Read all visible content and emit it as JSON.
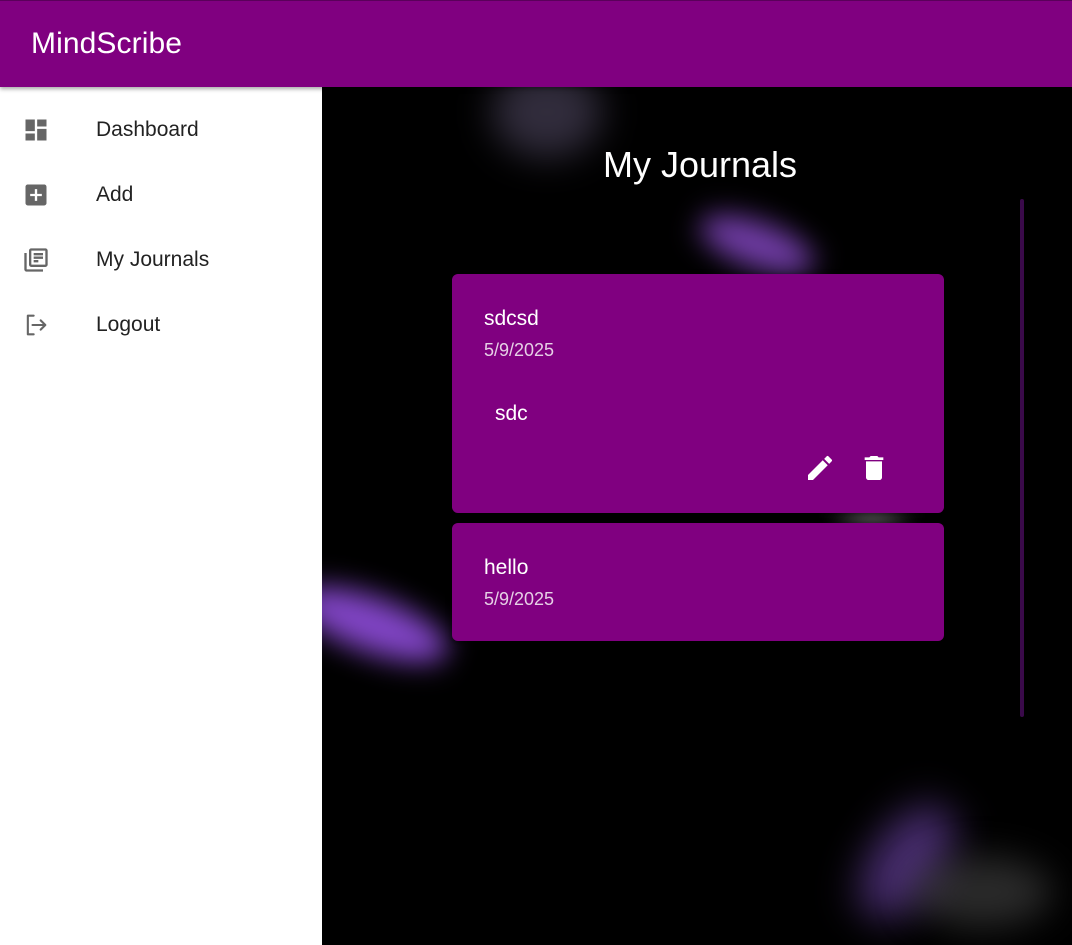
{
  "app": {
    "title": "MindScribe"
  },
  "sidebar": {
    "items": [
      {
        "label": "Dashboard",
        "icon": "dashboard-icon"
      },
      {
        "label": "Add",
        "icon": "add-box-icon"
      },
      {
        "label": "My Journals",
        "icon": "library-books-icon"
      },
      {
        "label": "Logout",
        "icon": "logout-icon"
      }
    ]
  },
  "main": {
    "heading": "My Journals",
    "journals": [
      {
        "title": "sdcsd",
        "date": "5/9/2025",
        "body": "sdc",
        "actions": [
          "edit-icon",
          "delete-icon"
        ]
      },
      {
        "title": "hello",
        "date": "5/9/2025"
      }
    ]
  },
  "colors": {
    "brand": "#800080",
    "background": "#000000",
    "drawer": "#ffffff",
    "glow": "#9b59e8"
  }
}
